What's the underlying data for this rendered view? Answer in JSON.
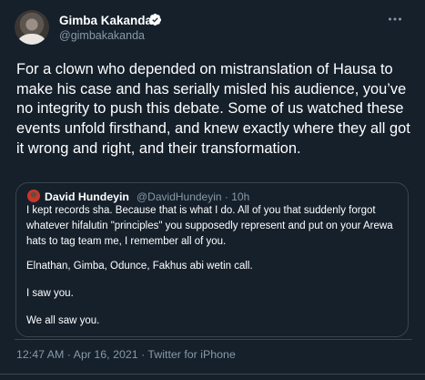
{
  "author": {
    "name": "Gimba Kakanda",
    "handle": "@gimbakakanda"
  },
  "tweet_text": "For a clown who depended on mistranslation of Hausa to make his case and has serially misled his audience, you’ve no integrity to push this debate. Some of us watched these events unfold firsthand, and knew exactly where they all got it wrong and right, and their transformation.",
  "quoted": {
    "name": "David Hundeyin",
    "handle_time": "@DavidHundeyin · 10h",
    "lines": [
      "I kept records sha. Because that is what I do. All of you that suddenly forgot",
      "whatever hifalutin \"principles\" you supposedly represent and put on your Arewa",
      "hats to tag team me, I remember all of you.",
      "Elnathan, Gimba, Odunce, Fakhus abi wetin call.",
      "I saw you.",
      "We all saw you."
    ]
  },
  "timestamp": "12:47 AM · Apr 16, 2021 · ",
  "source": "Twitter for iPhone",
  "colors": {
    "background": "#15202b",
    "secondary_text": "#8899a6",
    "border": "#38444d",
    "verified": "#ffffff"
  },
  "icons": {
    "verified": "verified-badge-icon",
    "more": "more-horizontal-icon"
  }
}
